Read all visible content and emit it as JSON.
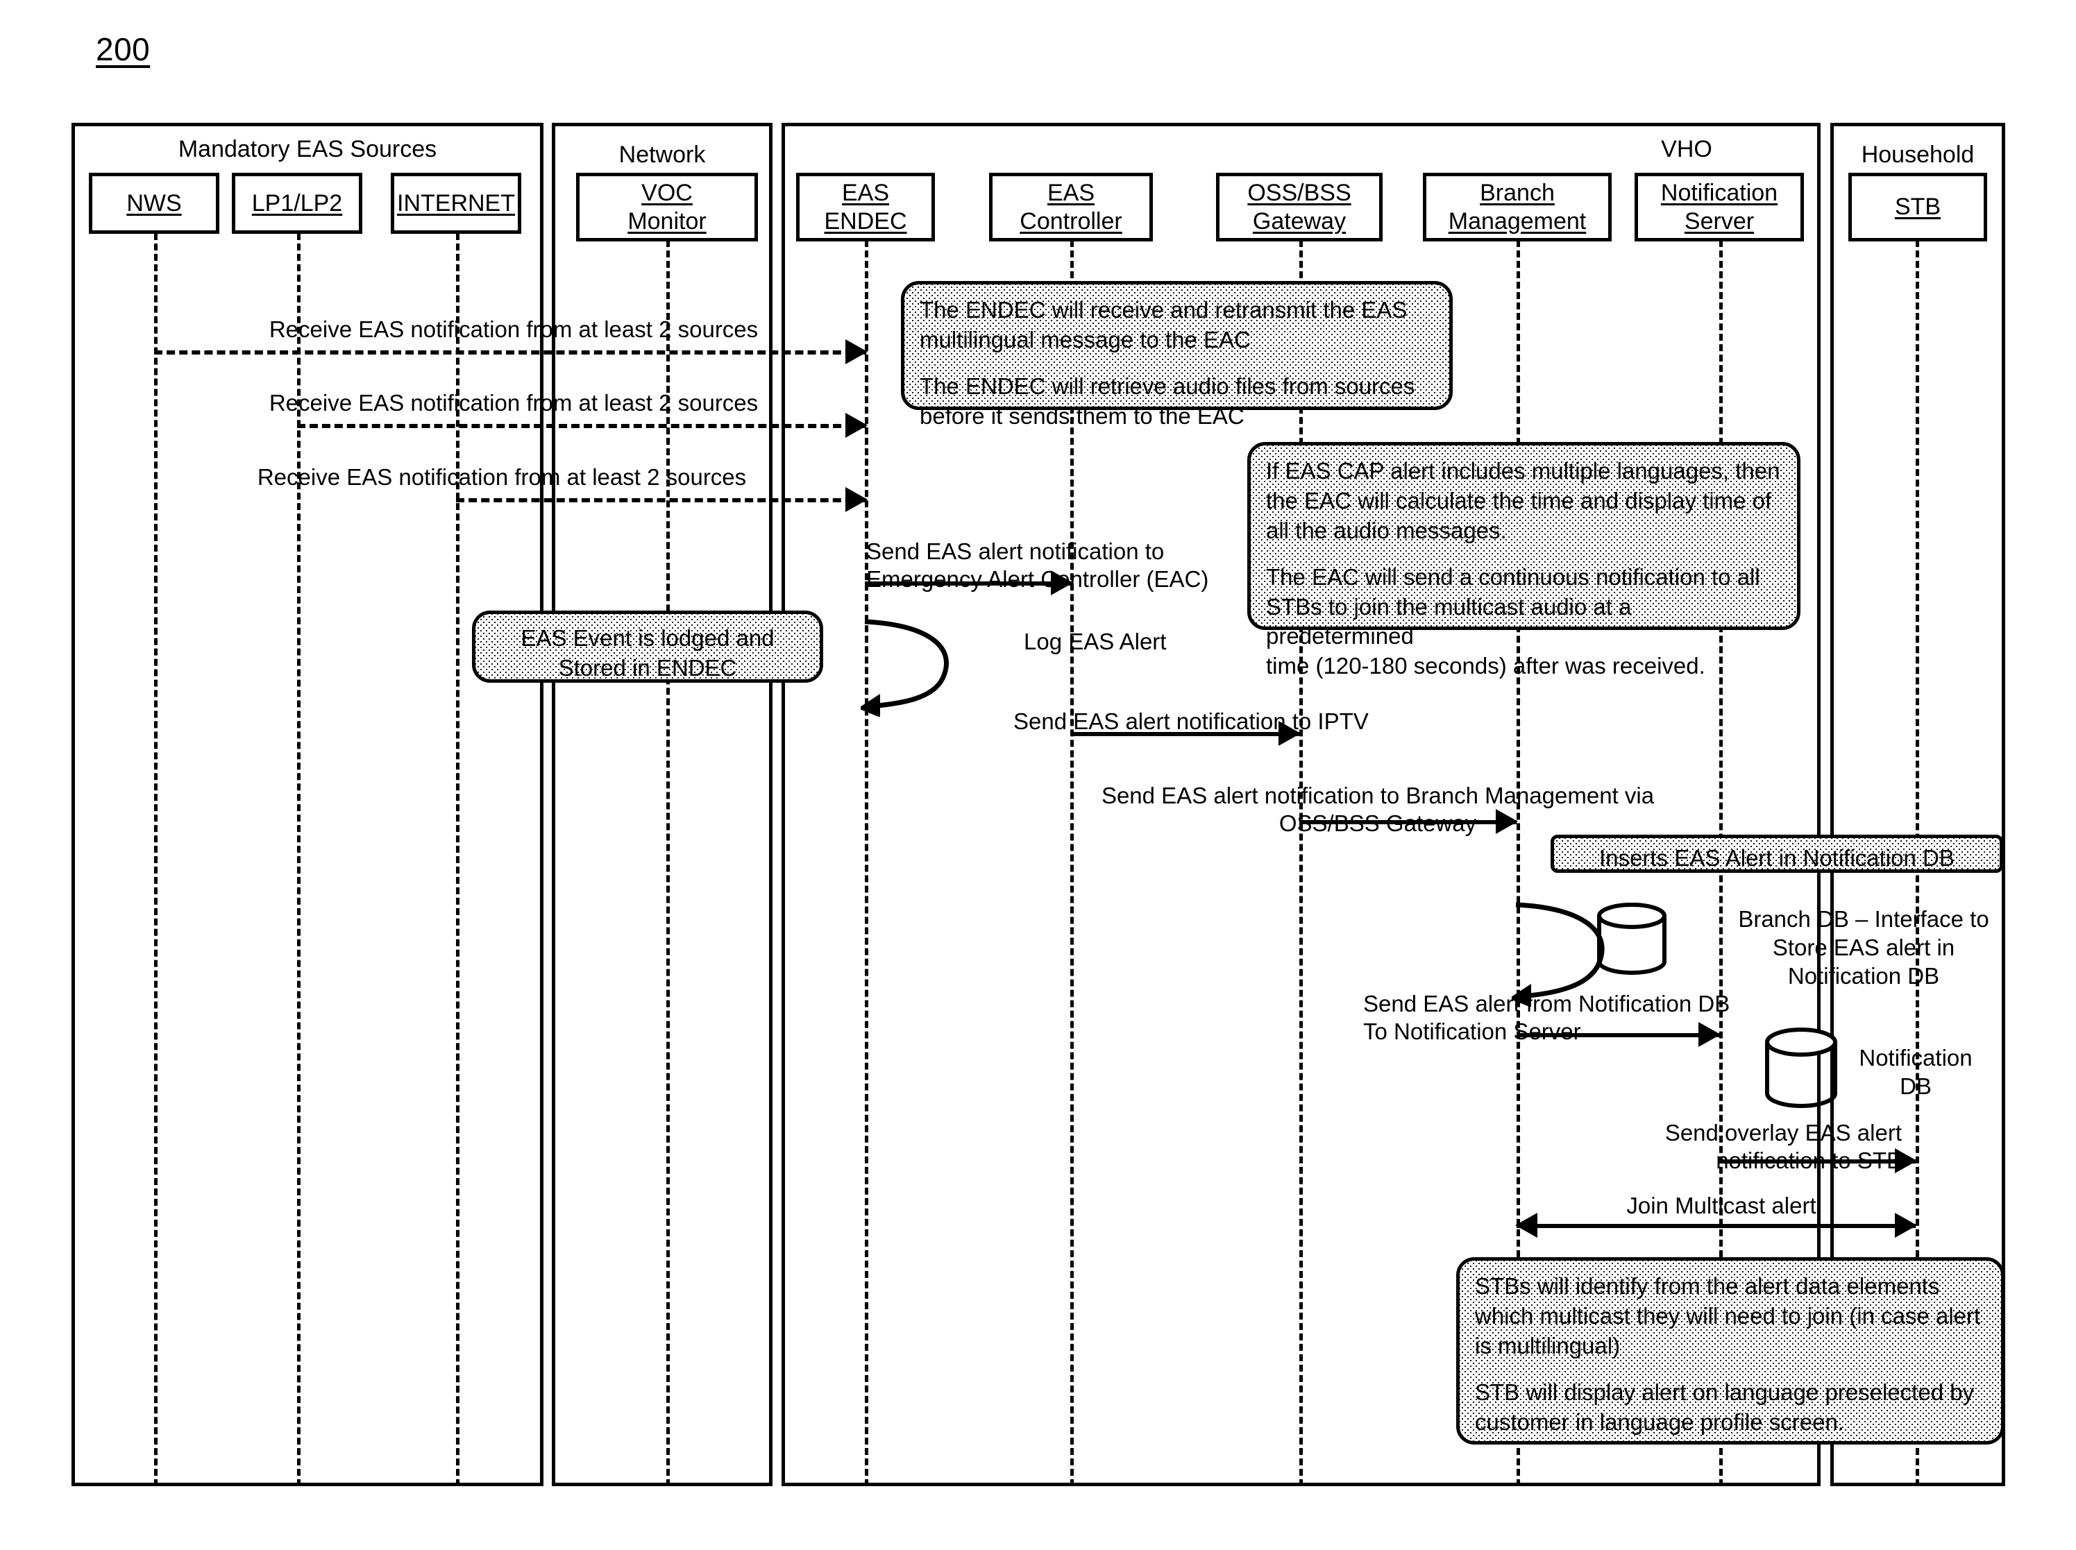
{
  "figure": {
    "number": "200"
  },
  "panels": [
    {
      "id": "mandatory-eas-sources",
      "title": "Mandatory EAS Sources"
    },
    {
      "id": "network",
      "title": "Network"
    },
    {
      "id": "vho",
      "title": "VHO"
    },
    {
      "id": "household",
      "title": "Household"
    }
  ],
  "lifelines": [
    {
      "id": "nws",
      "label": "NWS"
    },
    {
      "id": "lp1-lp2",
      "label": "LP1/LP2"
    },
    {
      "id": "internet",
      "label": "INTERNET"
    },
    {
      "id": "voc-monitor",
      "label": "VOC\nMonitor"
    },
    {
      "id": "eas-endec",
      "label": "EAS\nENDEC"
    },
    {
      "id": "eas-controller",
      "label": "EAS\nController"
    },
    {
      "id": "oss-bss-gateway",
      "label": "OSS/BSS\nGateway"
    },
    {
      "id": "branch-management",
      "label": "Branch\nManagement"
    },
    {
      "id": "notification-server",
      "label": "Notification\nServer"
    },
    {
      "id": "stb",
      "label": "STB"
    }
  ],
  "messages": [
    {
      "id": "m1",
      "label": "Receive EAS notification from at least 2 sources"
    },
    {
      "id": "m2",
      "label": "Receive EAS notification from at least 2 sources"
    },
    {
      "id": "m3",
      "label": "Receive EAS notification from at least 2 sources"
    },
    {
      "id": "m4",
      "label": "Send EAS alert notification to\nEmergency Alert Controller (EAC)"
    },
    {
      "id": "m5",
      "label": "Log EAS Alert"
    },
    {
      "id": "m6",
      "label": "Send EAS alert notification to IPTV"
    },
    {
      "id": "m7",
      "label": "Send EAS alert notification to Branch Management via\nOSS/BSS Gateway"
    },
    {
      "id": "m8",
      "label": "Send EAS alert from Notification DB\nTo Notification Server"
    },
    {
      "id": "m9",
      "label": "Send overlay EAS alert\nnotification to STB"
    },
    {
      "id": "m10",
      "label": "Join Multicast alert"
    }
  ],
  "notes": [
    {
      "id": "endec-note",
      "lines": [
        "The ENDEC will receive and  retransmit the EAS\nmultilingual message to the EAC",
        "The ENDEC will retrieve audio files from sources\nbefore it sends them to  the EAC"
      ]
    },
    {
      "id": "eac-note",
      "lines": [
        "If EAS CAP alert includes multiple languages, then\nthe EAC will calculate the time and display time of\nall the audio messages.",
        "The EAC will send a continuous notification to all\nSTBs to join the multicast audio at a predetermined\ntime (120-180 seconds) after was received."
      ]
    },
    {
      "id": "endec-store-note",
      "lines": [
        "EAS Event is lodged and\nStored in ENDEC"
      ]
    },
    {
      "id": "insert-db-note",
      "lines": [
        "Inserts EAS Alert in Notification DB"
      ]
    },
    {
      "id": "stb-note",
      "lines": [
        "STBs will identify from the alert data elements\nwhich multicast they will need to join (in case alert\nis multilingual)",
        "STB will display alert on language preselected by\ncustomer in language profile screen."
      ]
    }
  ],
  "annotations": [
    {
      "id": "branch-db-anno",
      "text": "Branch DB – Interface to\nStore EAS alert in\nNotification DB"
    },
    {
      "id": "notification-db-anno",
      "text": "Notification\nDB"
    }
  ],
  "colors": {
    "stroke": "#000000",
    "background": "#ffffff",
    "note_fill": "#ffffff"
  }
}
